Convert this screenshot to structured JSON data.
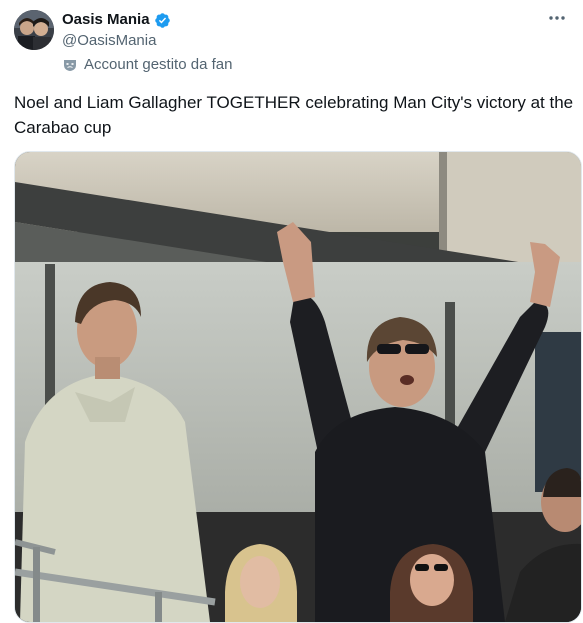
{
  "author": {
    "display_name": "Oasis Mania",
    "handle": "@OasisMania",
    "managed_label": "Account gestito da fan",
    "verified": true,
    "verified_color": "#1d9bf0"
  },
  "tweet": {
    "text": "Noel and Liam Gallagher TOGETHER celebrating Man City's victory at the Carabao cup"
  },
  "icons": {
    "more": "more-options-icon",
    "verified": "verified-badge-icon",
    "managed": "mask-icon"
  },
  "colors": {
    "text_primary": "#0f1419",
    "text_secondary": "#536471",
    "verified": "#1d9bf0"
  }
}
